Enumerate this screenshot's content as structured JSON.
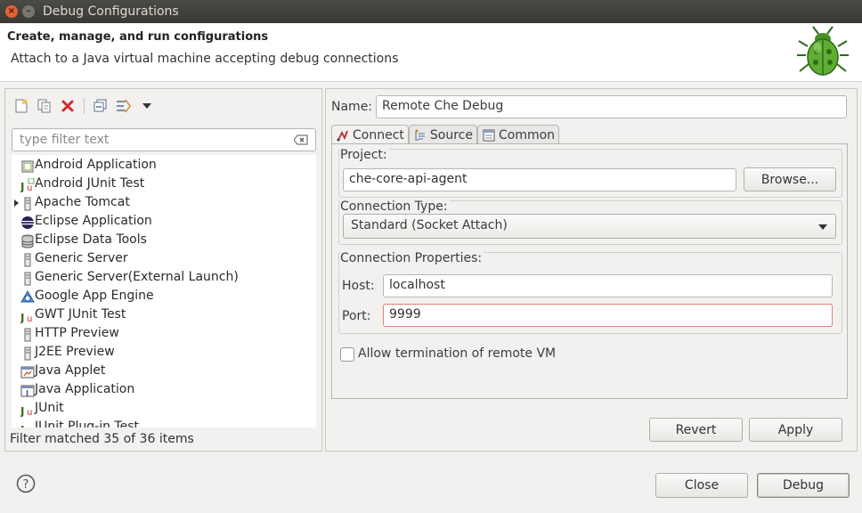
{
  "window": {
    "title": "Debug Configurations"
  },
  "banner": {
    "title": "Create, manage, and run configurations",
    "message": "Attach to a Java virtual machine accepting debug connections"
  },
  "toolbar": {
    "icons": [
      "new-configuration-icon",
      "duplicate-icon",
      "delete-icon",
      "collapse-all-icon",
      "filter-icon",
      "dropdown-icon"
    ]
  },
  "filter": {
    "placeholder": "type filter text",
    "status": "Filter matched 35 of 36 items"
  },
  "tree": {
    "items": [
      {
        "label": "Android Application",
        "icon": "android-application-icon"
      },
      {
        "label": "Android JUnit Test",
        "icon": "junit-icon"
      },
      {
        "label": "Apache Tomcat",
        "icon": "server-icon",
        "expandable": true
      },
      {
        "label": "Eclipse Application",
        "icon": "eclipse-icon"
      },
      {
        "label": "Eclipse Data Tools",
        "icon": "database-icon"
      },
      {
        "label": "Generic Server",
        "icon": "server-icon"
      },
      {
        "label": "Generic Server(External Launch)",
        "icon": "server-icon"
      },
      {
        "label": "Google App Engine",
        "icon": "app-engine-icon"
      },
      {
        "label": "GWT JUnit Test",
        "icon": "junit-icon"
      },
      {
        "label": "HTTP Preview",
        "icon": "server-icon"
      },
      {
        "label": "J2EE Preview",
        "icon": "server-icon"
      },
      {
        "label": "Java Applet",
        "icon": "applet-icon"
      },
      {
        "label": "Java Application",
        "icon": "java-application-icon"
      },
      {
        "label": "JUnit",
        "icon": "junit-icon"
      },
      {
        "label": "JUnit Plug-in Test",
        "icon": "junit-plugin-icon"
      }
    ]
  },
  "config": {
    "name_label": "Name:",
    "name_value": "Remote Che Debug",
    "tabs": [
      {
        "label": "Connect",
        "icon": "connect-icon",
        "active": true
      },
      {
        "label": "Source",
        "icon": "source-icon",
        "active": false
      },
      {
        "label": "Common",
        "icon": "common-icon",
        "active": false
      }
    ],
    "project": {
      "label": "Project:",
      "value": "che-core-api-agent",
      "browse": "Browse..."
    },
    "connection_type": {
      "label": "Connection Type:",
      "value": "Standard (Socket Attach)"
    },
    "connection_properties": {
      "label": "Connection Properties:",
      "host_label": "Host:",
      "host_value": "localhost",
      "port_label": "Port:",
      "port_value": "9999"
    },
    "allow_termination": {
      "label": "Allow termination of remote VM",
      "checked": false
    },
    "revert": "Revert",
    "apply": "Apply"
  },
  "footer": {
    "close": "Close",
    "debug": "Debug"
  }
}
